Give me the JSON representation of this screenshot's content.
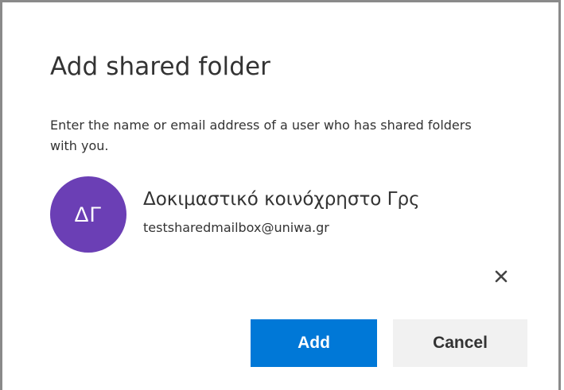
{
  "dialog": {
    "title": "Add shared folder",
    "description": "Enter the name or email address of a user who has shared folders with you."
  },
  "selected_user": {
    "initials": "ΔΓ",
    "display_name": "Δοκιμαστικό κοινόχρηστο Γρς",
    "email": "testsharedmailbox@uniwa.gr",
    "avatar_color": "#6b3fb5",
    "remove_icon": "close-icon"
  },
  "actions": {
    "add_label": "Add",
    "cancel_label": "Cancel",
    "primary_color": "#0078d7"
  }
}
